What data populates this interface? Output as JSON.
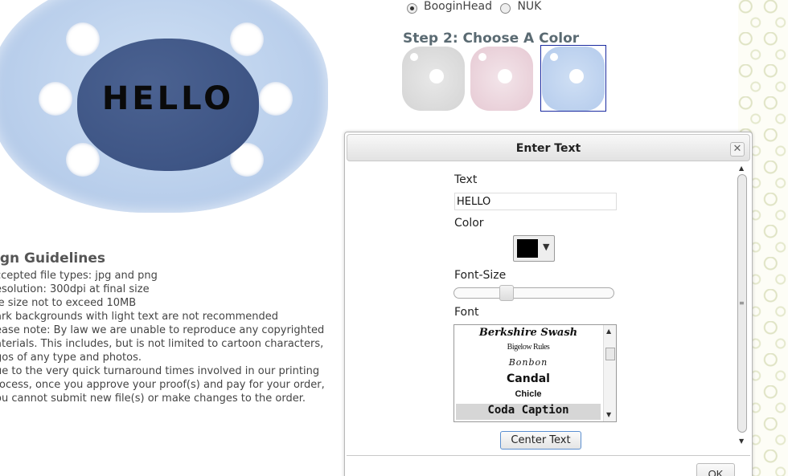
{
  "preview": {
    "pacifier_text": "HELLO"
  },
  "guidelines": {
    "heading": "ign Guidelines",
    "lines": [
      "ccepted file types: jpg and png",
      "esolution: 300dpi at final size",
      "le size not to exceed 10MB",
      "ark backgrounds with light text are not recommended",
      "ease note: By law we are unable to reproduce any copyrighted",
      "aterials. This includes, but is not limited to cartoon characters,",
      "gos of any type and photos.",
      "ue to the very quick turnaround times involved in our printing",
      "rocess, once you approve your proof(s) and pay for your order,",
      "ou cannot submit new file(s) or make changes to the order."
    ]
  },
  "brands": {
    "options": [
      "BooginHead",
      "NUK"
    ],
    "selected": "BooginHead"
  },
  "step2": {
    "title": "Step 2: Choose A Color",
    "swatches": [
      {
        "name": "white",
        "color": "#d9d9d9"
      },
      {
        "name": "pink",
        "color": "#e8ccd6"
      },
      {
        "name": "blue",
        "color": "#b8cdee",
        "selected": true
      }
    ]
  },
  "dialog": {
    "title": "Enter Text",
    "close_icon": "close-icon",
    "text_label": "Text",
    "text_value": "HELLO",
    "color_label": "Color",
    "selected_color": "#000000",
    "font_size_label": "Font-Size",
    "font_size_value_fraction": 0.31,
    "font_label": "Font",
    "fonts": [
      "Berkshire Swash",
      "Bigelow Rules",
      "Bonbon",
      "Candal",
      "Chicle",
      "Coda Caption"
    ],
    "selected_font": "Coda Caption",
    "center_button": "Center Text",
    "ok_button": "OK"
  }
}
